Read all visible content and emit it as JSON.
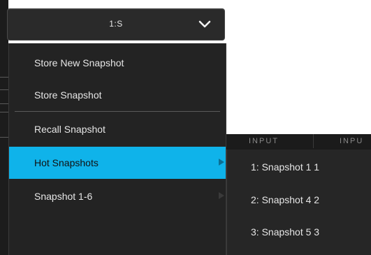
{
  "selector": {
    "value": "1:S"
  },
  "menu": {
    "items": [
      {
        "label": "Store New Snapshot"
      },
      {
        "label": "Store Snapshot"
      },
      {
        "label": "Recall Snapshot"
      },
      {
        "label": "Hot Snapshots"
      },
      {
        "label": "Snapshot 1-6"
      }
    ]
  },
  "background": {
    "headers": [
      "INPUT",
      "INPU"
    ]
  },
  "submenu": {
    "items": [
      {
        "label": "1: Snapshot 1 1"
      },
      {
        "label": "2: Snapshot 4 2"
      },
      {
        "label": "3: Snapshot 5 3"
      }
    ]
  },
  "colors": {
    "highlight": "#0fb3ea",
    "menu_bg": "#232323",
    "text": "#e6e6e6"
  },
  "icons": {
    "selector_chevron": "chevron-down-icon",
    "submenu_arrow": "triangle-right-icon"
  }
}
